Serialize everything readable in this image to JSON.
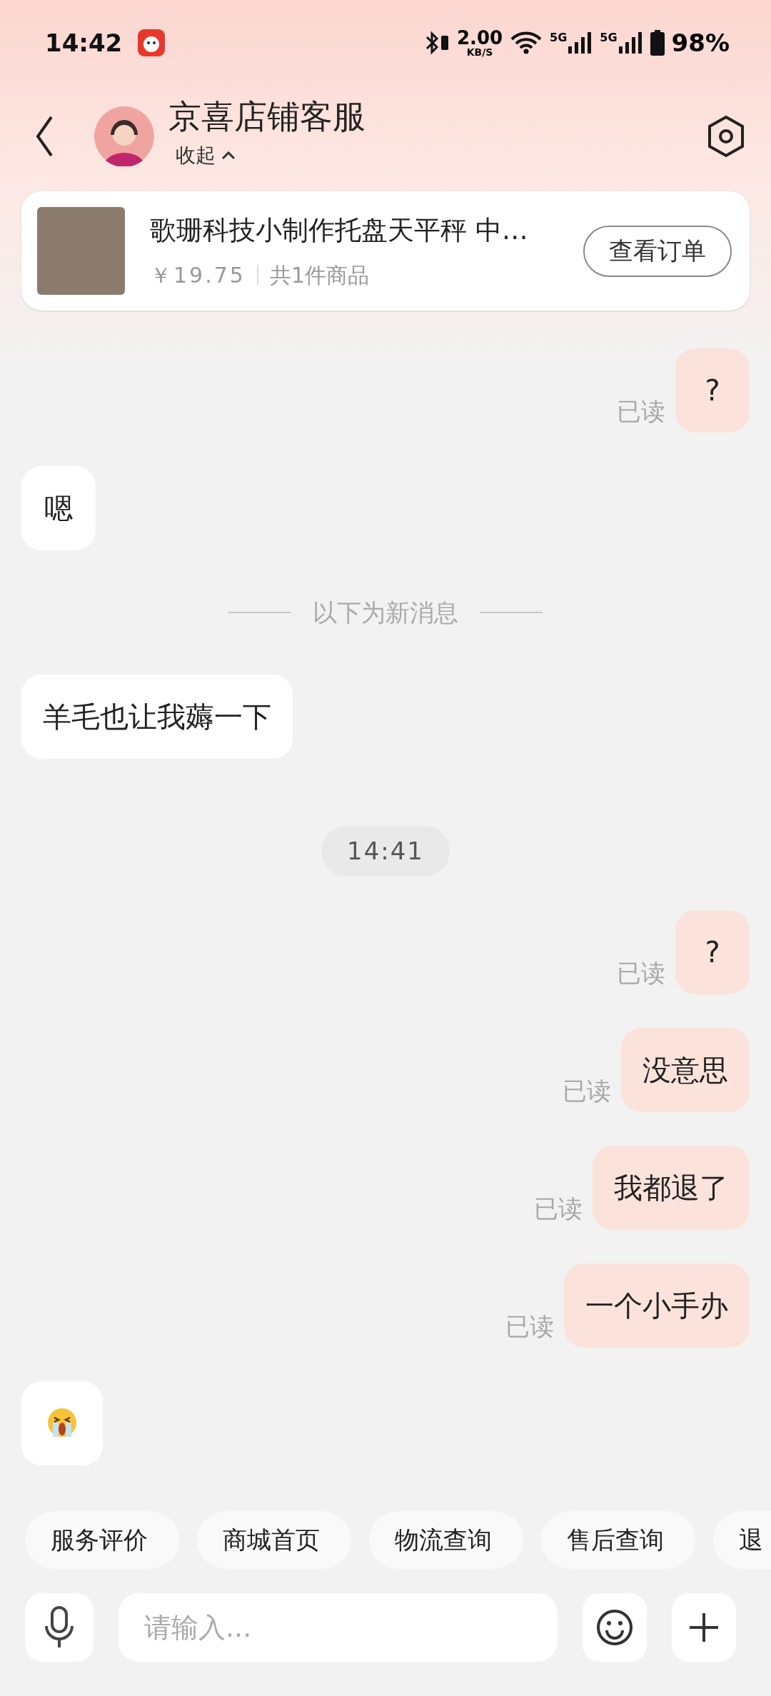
{
  "status_bar": {
    "time": "14:42",
    "net_speed": "2.00",
    "net_unit": "KB/S",
    "sim_1": "5G",
    "sim_2": "5G",
    "battery": "98%"
  },
  "header": {
    "title": "京喜店铺客服",
    "collapse": "收起"
  },
  "order_card": {
    "title": "歌珊科技小制作托盘天平秤  中…",
    "price": "￥19.75",
    "count": "共1件商品",
    "button": "查看订单"
  },
  "messages": [
    {
      "kind": "sent",
      "text": "?",
      "status": "已读"
    },
    {
      "kind": "received",
      "text": "嗯"
    },
    {
      "kind": "divider",
      "text": "以下为新消息"
    },
    {
      "kind": "received",
      "text": "羊毛也让我薅一下"
    },
    {
      "kind": "timestamp",
      "text": "14:41"
    },
    {
      "kind": "sent",
      "text": "?",
      "status": "已读"
    },
    {
      "kind": "sent",
      "text": "没意思",
      "status": "已读"
    },
    {
      "kind": "sent",
      "text": "我都退了",
      "status": "已读"
    },
    {
      "kind": "sent",
      "text": "一个小手办",
      "status": "已读"
    },
    {
      "kind": "received-emoji"
    }
  ],
  "quick_replies": [
    "服务评价",
    "商城首页",
    "物流查询",
    "售后查询",
    "退"
  ],
  "input": {
    "placeholder": "请输入..."
  }
}
